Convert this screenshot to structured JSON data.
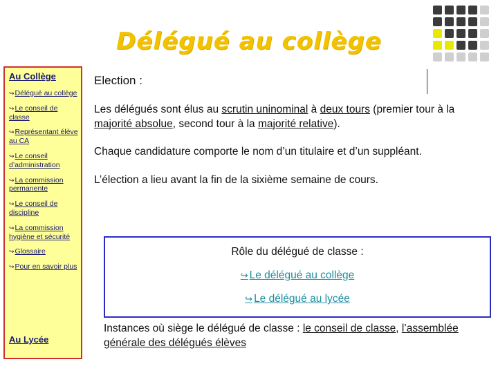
{
  "title": "Délégué au collège",
  "colors": {
    "title": "#f2c200",
    "sidebar_bg": "#ffff99",
    "sidebar_border": "#d03030",
    "sidebar_text": "#1a1a6e",
    "box_border": "#2b2bc4",
    "link": "#1a8fa0",
    "dot_dark": "#3b3b3b",
    "dot_yellow": "#e8e800",
    "dot_gray": "#cfcfcf"
  },
  "dot_grid": {
    "rows": 5,
    "cols": 5,
    "pattern": [
      [
        "dark",
        "dark",
        "dark",
        "dark",
        "gray"
      ],
      [
        "dark",
        "dark",
        "dark",
        "dark",
        "gray"
      ],
      [
        "yellow",
        "dark",
        "dark",
        "dark",
        "gray"
      ],
      [
        "yellow",
        "yellow",
        "dark",
        "dark",
        "gray"
      ],
      [
        "gray",
        "gray",
        "gray",
        "gray",
        "gray"
      ]
    ]
  },
  "sidebar": {
    "heading_top": "Au Collège",
    "heading_bottom": "Au Lycée",
    "bullet_glyph": "↪",
    "items": [
      {
        "label": "Délégué au collège"
      },
      {
        "label": "Le conseil de classe"
      },
      {
        "label": "Représentant élève au CA"
      },
      {
        "label": "Le conseil d’administration"
      },
      {
        "label": "La commission permanente"
      },
      {
        "label": "Le conseil de discipline"
      },
      {
        "label": "La commission hygiène et sécurité"
      },
      {
        "label": "Glossaire"
      },
      {
        "label": "Pour en savoir plus"
      }
    ]
  },
  "main": {
    "election_label": "Election :",
    "paragraph1": {
      "seg1": "Les délégués sont élus au ",
      "u1": "scrutin uninominal",
      "seg2": " à ",
      "u2": "deux tours",
      "seg3": " (premier tour à la ",
      "u3": "majorité absolue",
      "seg4": ", second tour à la ",
      "u4": "majorité relative",
      "seg5": ")."
    },
    "paragraph2": "Chaque candidature comporte le nom d’un titulaire et d’un suppléant.",
    "paragraph3": "L’élection a lieu avant la fin de la sixième semaine de cours.",
    "role_box": {
      "title": "Rôle du délégué de classe :",
      "arrow_glyph": "↪",
      "link1": "Le délégué au collège",
      "link2": "Le délégué au lycée"
    },
    "bottom_paragraph": {
      "seg1": "Instances où siège le délégué de classe",
      "seg2": " : ",
      "u1": "le conseil de classe",
      "seg3": ", ",
      "u2": "l’assemblée générale des délégués élèves"
    }
  }
}
